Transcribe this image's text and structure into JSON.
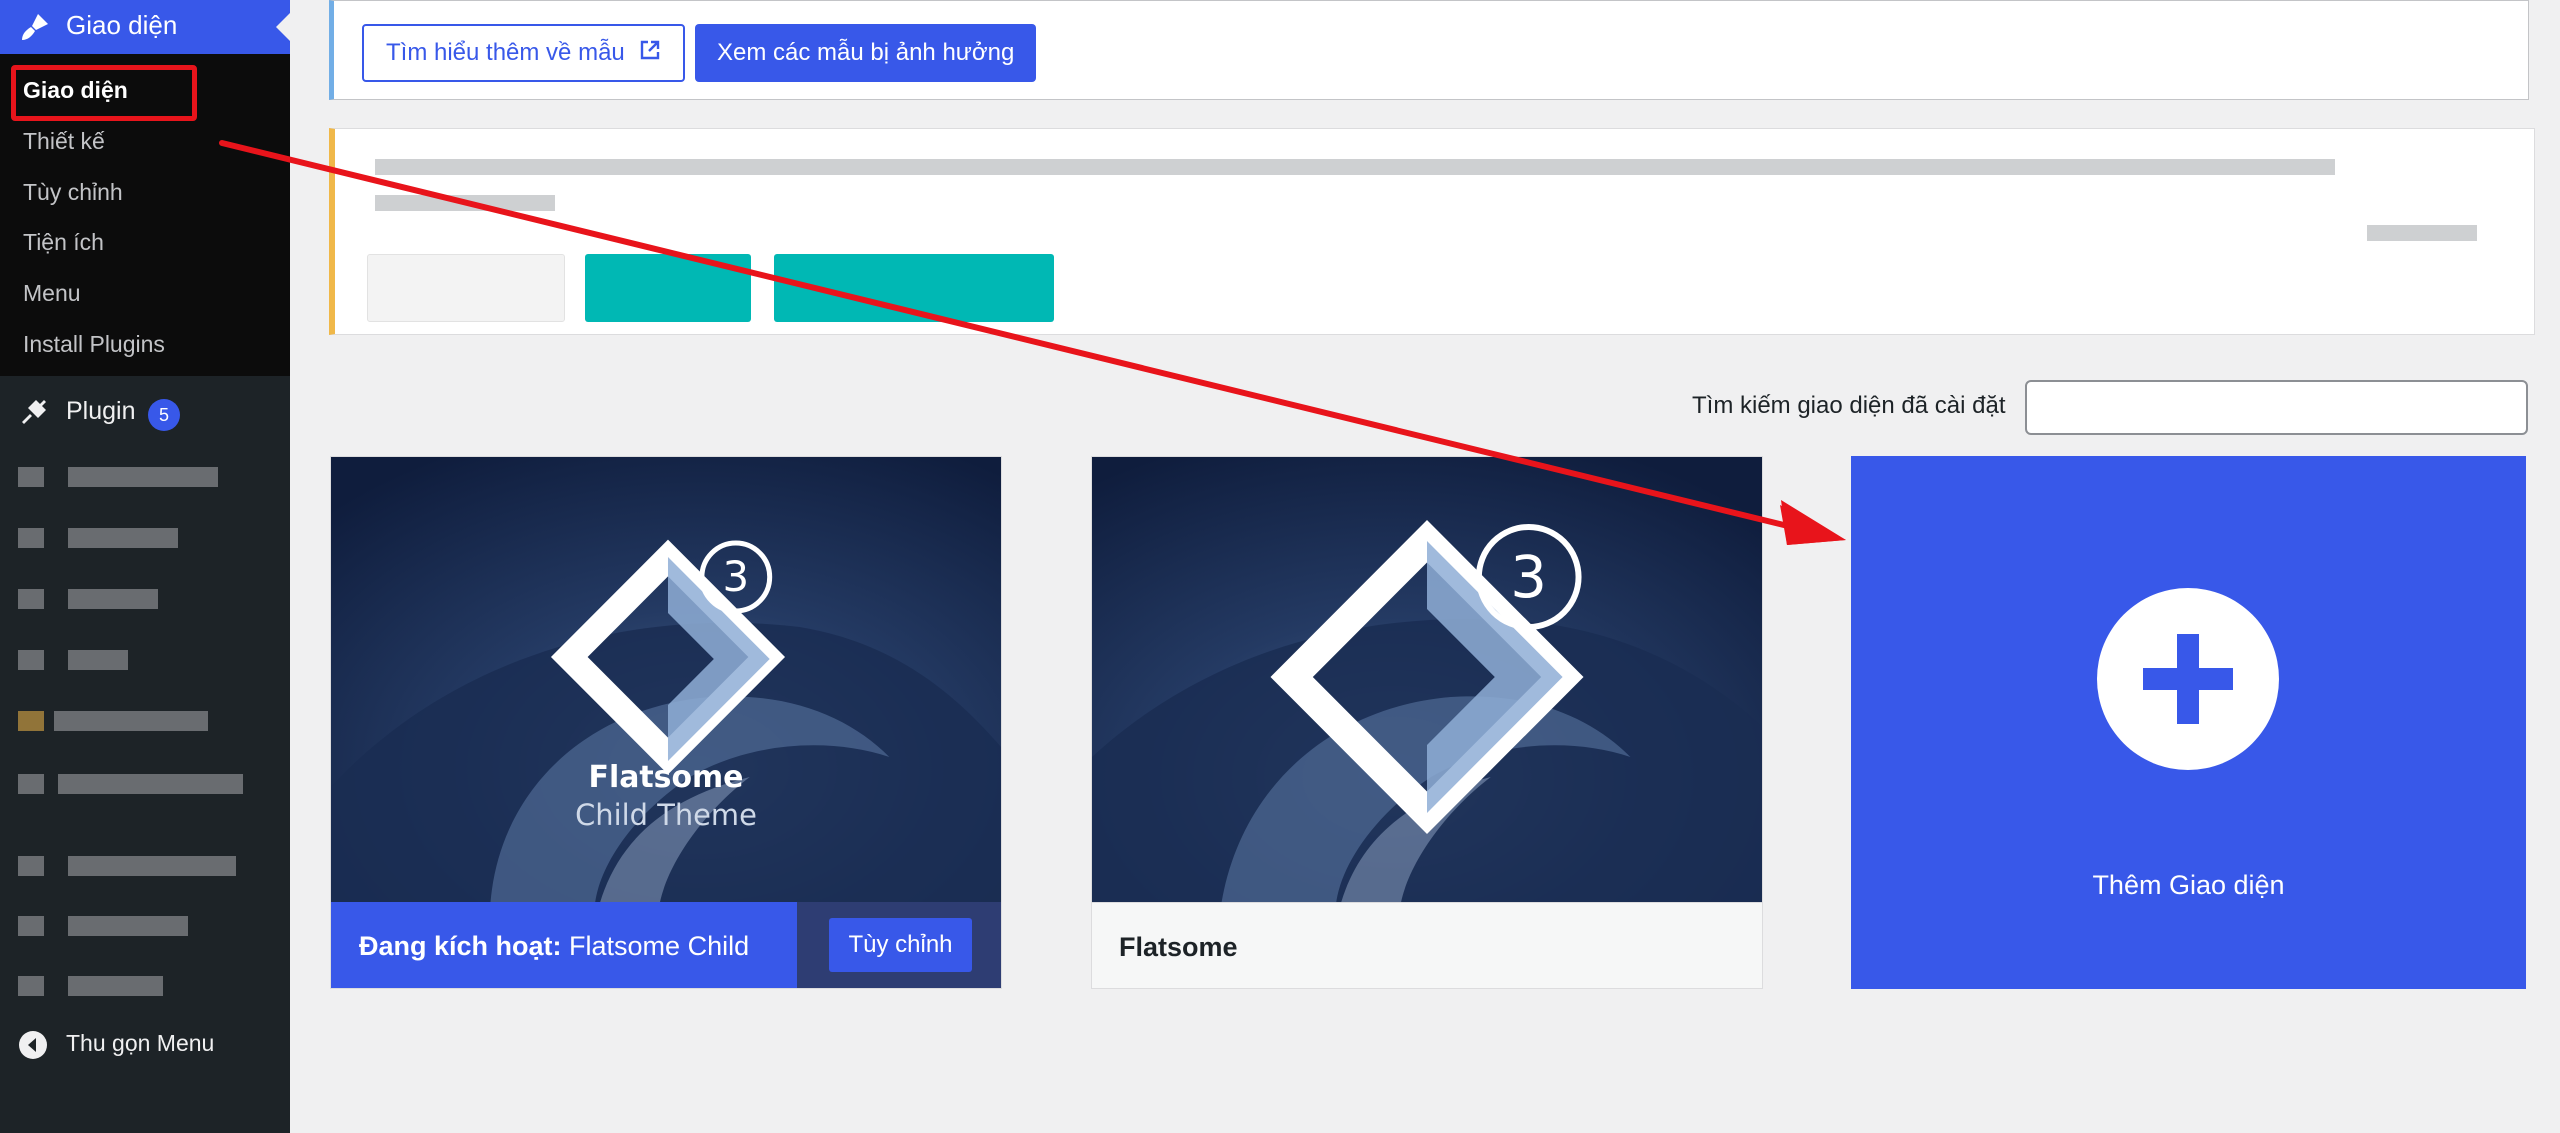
{
  "sidebar": {
    "appearance_label": "Giao diện",
    "submenu": [
      "Giao diện",
      "Thiết kế",
      "Tùy chỉnh",
      "Tiện ích",
      "Menu",
      "Install Plugins"
    ],
    "plugin_label": "Plugin",
    "plugin_badge": "5",
    "collapse_label": "Thu gọn Menu"
  },
  "notice": {
    "learn_more_label": "Tìm hiểu thêm về mẫu",
    "affected_label": "Xem các mẫu bị ảnh hưởng"
  },
  "search": {
    "label": "Tìm kiếm giao diện đã cài đặt",
    "value": ""
  },
  "themes": {
    "active": {
      "prefix": "Đang kích hoạt:",
      "name": "Flatsome Child",
      "customize_label": "Tùy chỉnh",
      "screenshot_title": "Flatsome",
      "screenshot_subtitle": "Child Theme",
      "version_badge": "3"
    },
    "second": {
      "name": "Flatsome",
      "version_badge": "3"
    },
    "add_label": "Thêm Giao diện"
  },
  "colors": {
    "accent": "#3858e9",
    "annotation": "#e8141b",
    "warning": "#f0b849",
    "info": "#72aee6",
    "teal": "#00b8b4"
  }
}
